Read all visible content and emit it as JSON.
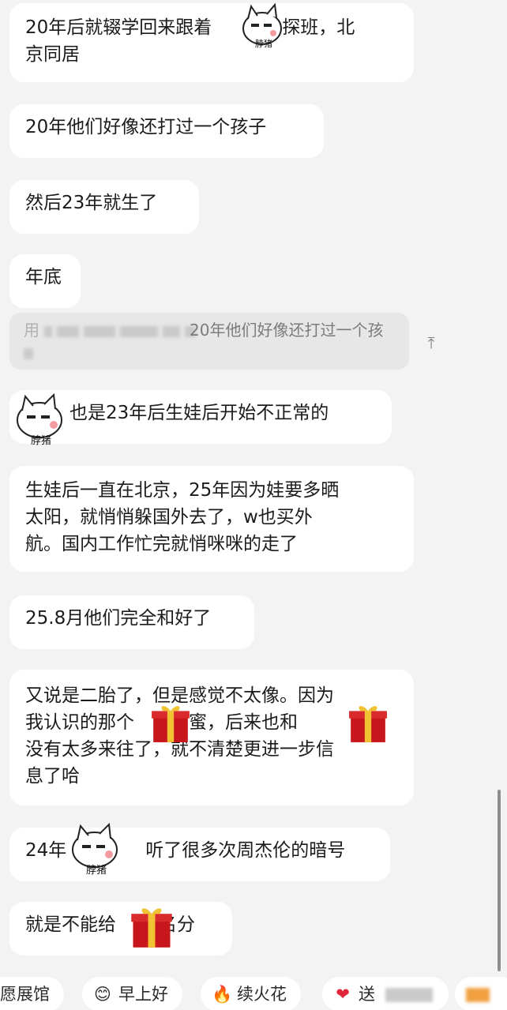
{
  "messages": [
    {
      "line1": "20年后就辍学回来跟着",
      "line1b": "，探班，北",
      "line2": "京同居"
    },
    {
      "text": "20年他们好像还打过一个孩子"
    },
    {
      "text": "然后23年就生了"
    },
    {
      "text": "年底"
    },
    {
      "text": "也是23年后生娃后开始不正常的"
    },
    {
      "line1": "生娃后一直在北京，25年因为娃要多晒",
      "line2": "太阳，就悄悄躲国外去了，w也买外",
      "line3": "航。国内工作忙完就悄咪咪的走了"
    },
    {
      "text": "25.8月他们完全和好了"
    },
    {
      "line1": "又说是二胎了，但是感觉不太像。因为",
      "line2a": "我认识的那个",
      "line2b": "闺蜜，后来也和",
      "line3": "没有太多来往了，就不清楚更进一步信",
      "line4": "息了哈"
    },
    {
      "a": "24年",
      "b": "听了很多次周杰伦的暗号"
    },
    {
      "a": "就是不能给",
      "b": "名分"
    }
  ],
  "quote": {
    "text": "20年他们好像还打过一个孩",
    "prefix": "用"
  },
  "sticker_caption": "脖猪",
  "quick_bar": [
    {
      "label": "愿展馆",
      "icon": ""
    },
    {
      "label": "早上好",
      "icon": "😊"
    },
    {
      "label": "续火花",
      "icon": "🔥"
    },
    {
      "label": "送",
      "icon": "❤"
    }
  ],
  "colors": {
    "bubble": "#ffffff",
    "background": "#f3f3f3",
    "gift": "#c8171c"
  }
}
